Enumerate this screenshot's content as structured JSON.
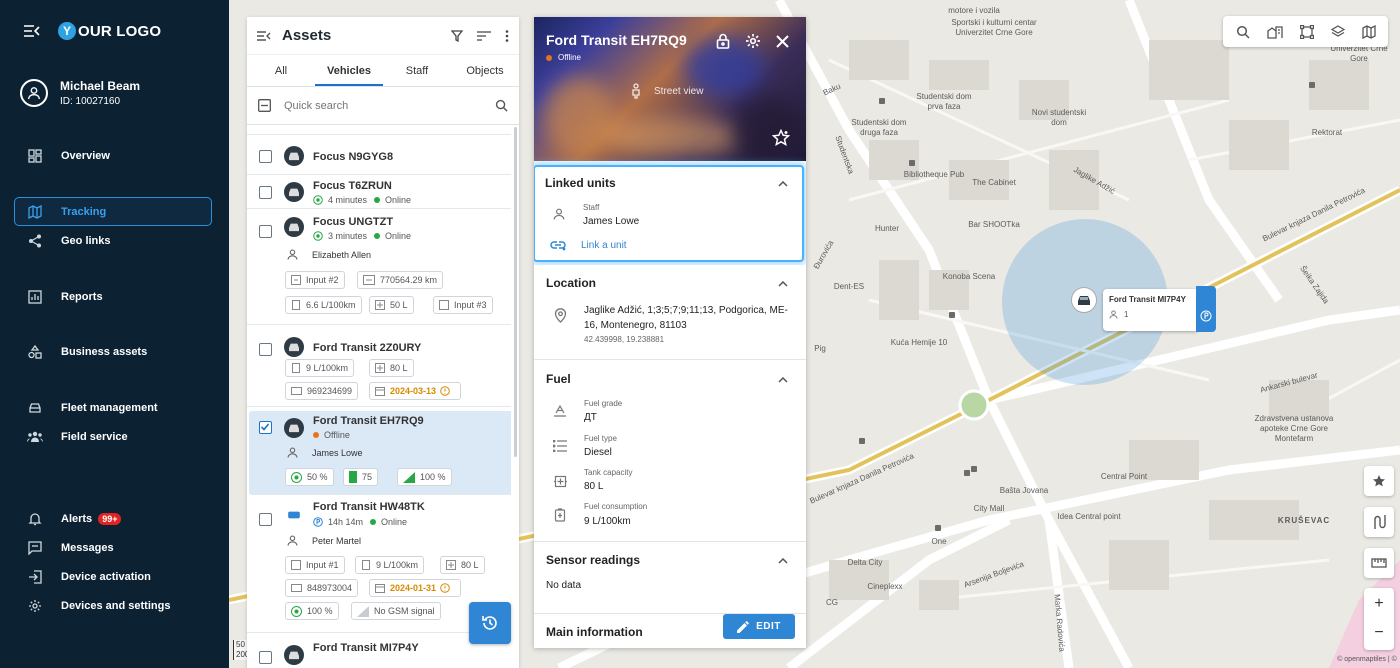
{
  "sidebar": {
    "logo": "OUR LOGO",
    "logo_letter": "Y",
    "user_name": "Michael Beam",
    "user_id": "ID: 10027160",
    "items": [
      {
        "label": "Overview"
      },
      {
        "label": "Tracking"
      },
      {
        "label": "Geo links"
      },
      {
        "label": "Reports"
      },
      {
        "label": "Business assets"
      },
      {
        "label": "Fleet management"
      },
      {
        "label": "Field service"
      },
      {
        "label": "Alerts"
      },
      {
        "label": "Messages"
      },
      {
        "label": "Device activation"
      },
      {
        "label": "Devices and settings"
      }
    ],
    "alerts_badge": "99+"
  },
  "assets": {
    "title": "Assets",
    "tabs": [
      "All",
      "Vehicles",
      "Staff",
      "Objects"
    ],
    "search_placeholder": "Quick search",
    "rows": [
      {
        "name": "Focus N9GYG8"
      },
      {
        "name": "Focus T6ZRUN",
        "status": "4 minutes",
        "online": "Online"
      },
      {
        "name": "Focus UNGTZT",
        "status": "3 minutes",
        "online": "Online",
        "driver": "Elizabeth Allen",
        "chips": [
          "Input #2",
          "770564.29 km",
          "6.6 L/100km",
          "50 L",
          "Input #3"
        ]
      },
      {
        "name": "Ford Transit 2Z0URY",
        "chips": [
          "9 L/100km",
          "80 L",
          "969234699",
          "2024-03-13"
        ]
      },
      {
        "name": "Ford Transit EH7RQ9",
        "status": "Offline",
        "driver": "James Lowe",
        "chips": [
          "50 %",
          "75",
          "100 %"
        ]
      },
      {
        "name": "Ford Transit HW48TK",
        "status": "14h 14m",
        "online": "Online",
        "driver": "Peter Martel",
        "chips": [
          "Input #1",
          "9 L/100km",
          "80 L",
          "848973004",
          "2024-01-31",
          "100 %",
          "No GSM signal"
        ]
      },
      {
        "name": "Ford Transit MI7P4Y"
      }
    ]
  },
  "detail": {
    "title": "Ford Transit EH7RQ9",
    "status": "Offline",
    "street_view": "Street view",
    "linked": {
      "title": "Linked units",
      "staff_label": "Staff",
      "staff_name": "James Lowe",
      "link_action": "Link a unit"
    },
    "location": {
      "title": "Location",
      "address": "Jaglike Adžić, 1;3;5;7;9;11;13, Podgorica, ME-16, Montenegro, 81103",
      "coords": "42.439998, 19.238881"
    },
    "fuel": {
      "title": "Fuel",
      "grade_label": "Fuel grade",
      "grade": "ДТ",
      "type_label": "Fuel type",
      "type": "Diesel",
      "tank_label": "Tank capacity",
      "tank": "80 L",
      "cons_label": "Fuel consumption",
      "cons": "9 L/100km"
    },
    "sensors": {
      "title": "Sensor readings",
      "value": "No data"
    },
    "main_info": "Main information",
    "edit": "EDIT"
  },
  "map": {
    "popup_name": "Ford Transit MI7P4Y",
    "popup_count": "1",
    "scale_top": "50",
    "scale_bottom": "200 ft",
    "attribution": "© openmaptiles | ©",
    "labels": [
      "Sportski i kulturni centar Univerzitet Crne Gore",
      "motore i vozila",
      "Univerzitet Crne Gore",
      "Studentski dom prva faza",
      "Novi studentski dom",
      "Studentski dom druga faza",
      "Rektorat",
      "Bibliotheque Pub",
      "The Cabinet",
      "Hunter",
      "Bar SHOOTka",
      "Konoba Scena",
      "Dent-ES",
      "Kuća Hemije 10",
      "Zdravstvena ustanova apoteke Crne Gore Montefarm",
      "Central Point",
      "Idea Central point",
      "Bašta Jovana",
      "City Mall",
      "One",
      "Delta City",
      "Cineplexx",
      "Kruševac",
      "Baku",
      "Studentska",
      "Jaglike Adžić",
      "Bulevar knjaza Danila Petrovića",
      "Šeika Zajida",
      "Ankarski bulevar",
      "Arsenija Boljevića",
      "Marka Radovića",
      "Đurovića",
      "Pig",
      "CG"
    ]
  }
}
